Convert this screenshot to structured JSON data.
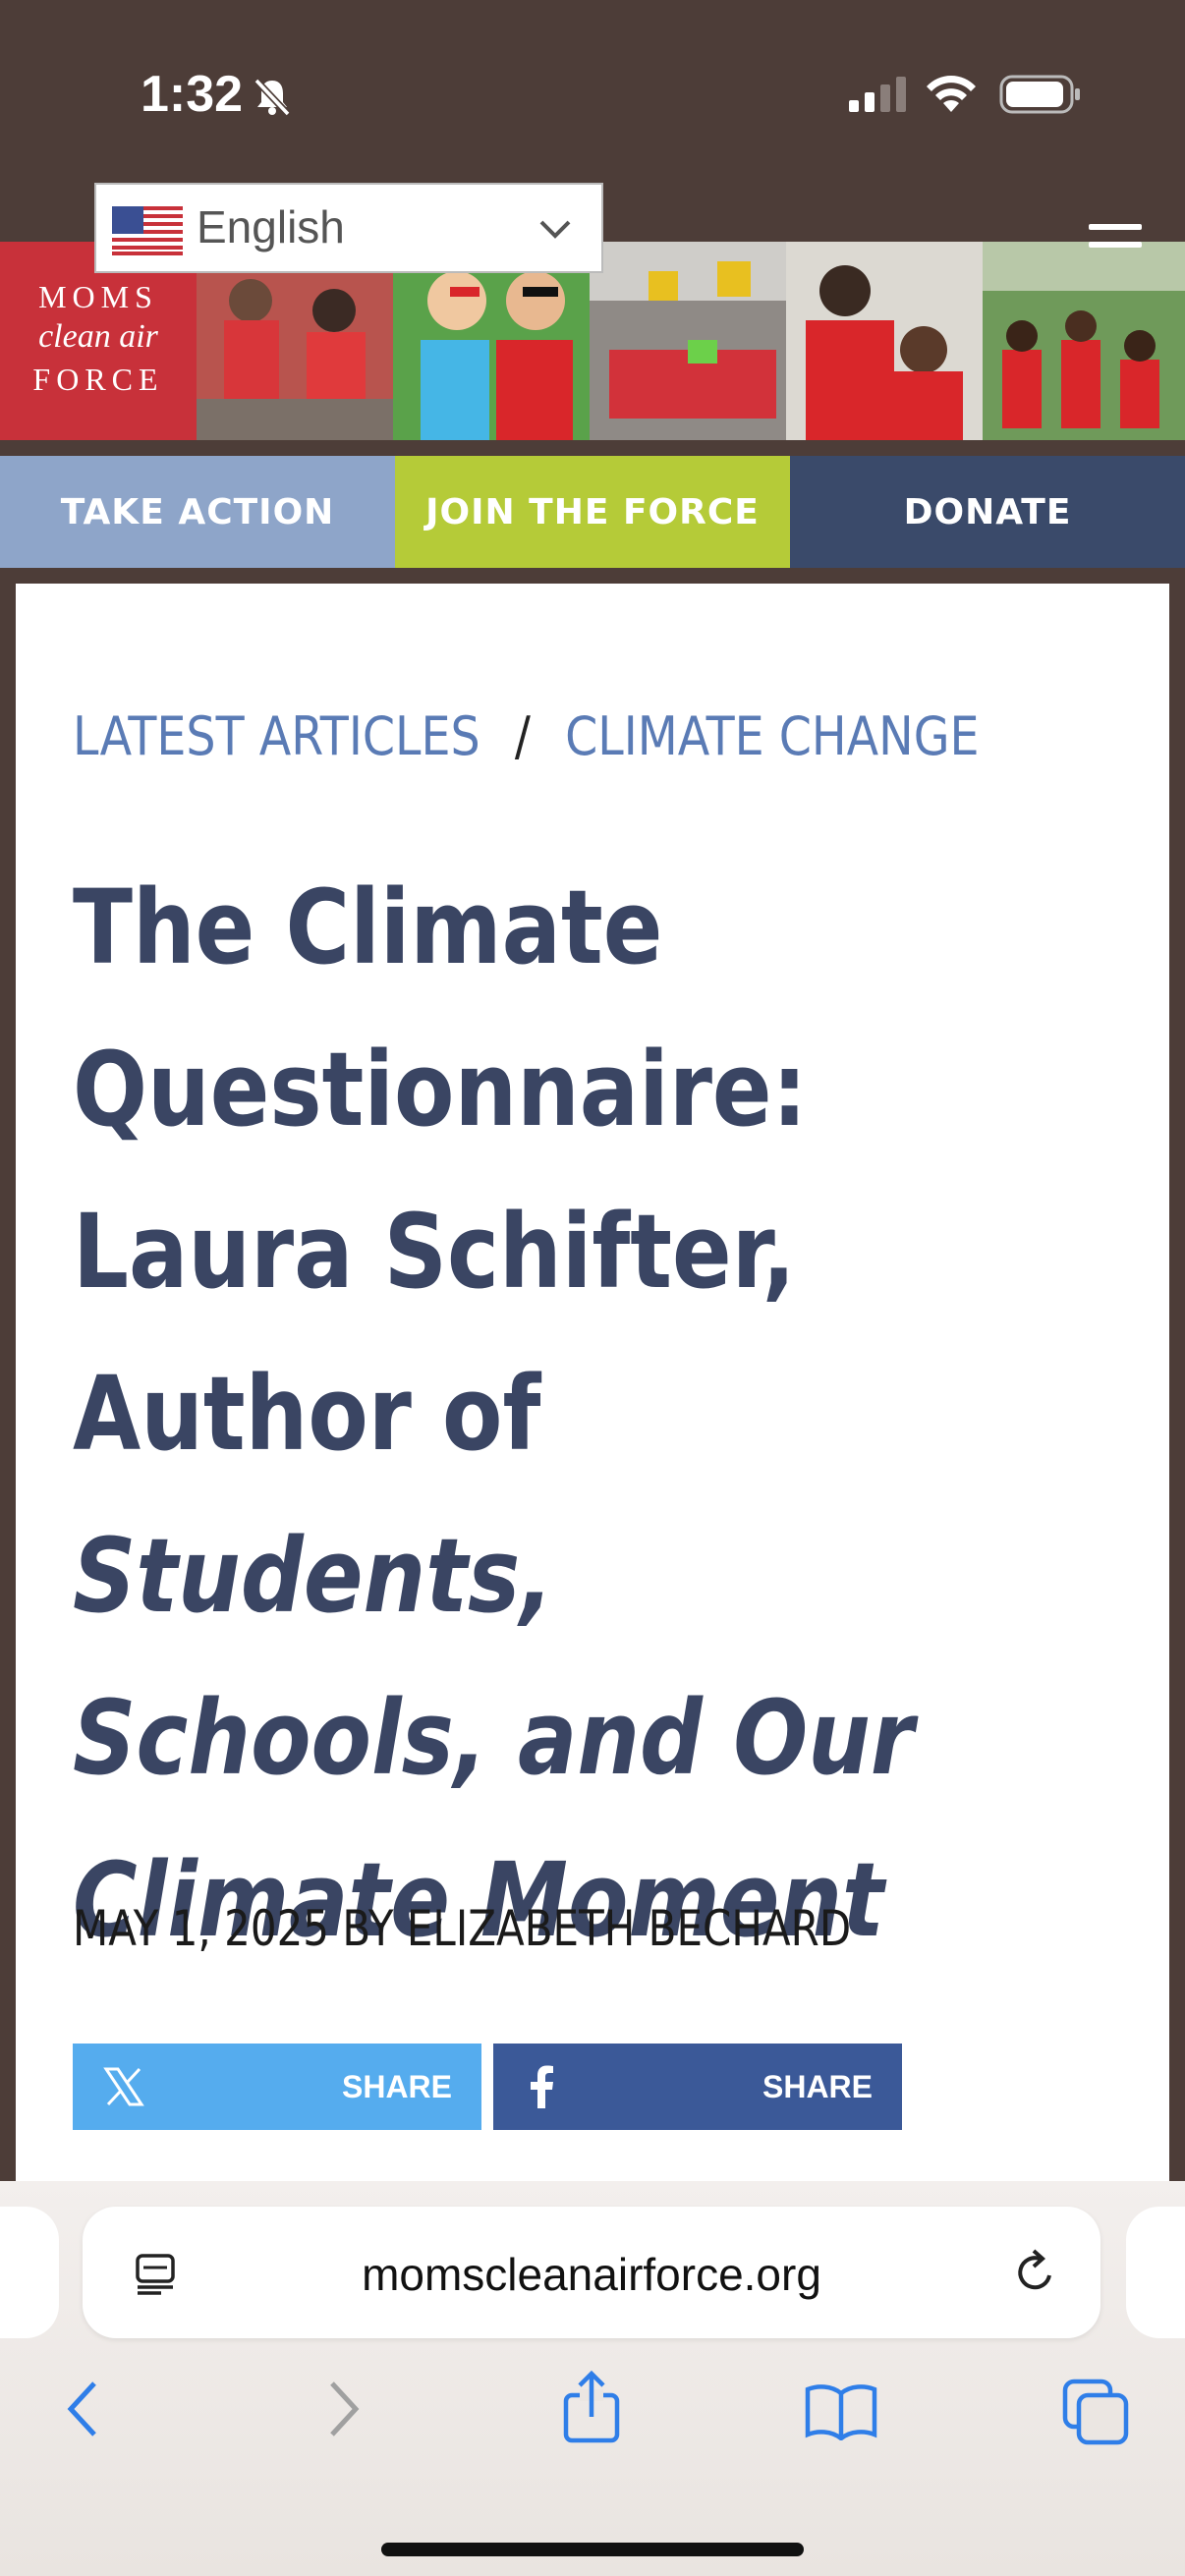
{
  "status_bar": {
    "time": "1:32"
  },
  "language_selector": {
    "label": "English"
  },
  "logo": {
    "line1": "MOMS",
    "line2": "clean air",
    "line3": "FORCE"
  },
  "nav": {
    "take_action": "TAKE ACTION",
    "join": "JOIN THE FORCE",
    "donate": "DONATE"
  },
  "breadcrumb": {
    "item1": "LATEST ARTICLES",
    "separator": "/",
    "item2": "CLIMATE CHANGE"
  },
  "article": {
    "title_plain": "The Climate Questionnaire: Laura Schifter, Author of",
    "title_italic": "Students, Schools, and Our Climate Moment",
    "byline": "MAY 1, 2025 BY ELIZABETH BECHARD"
  },
  "share": {
    "x_label": "SHARE",
    "facebook_label": "SHARE"
  },
  "browser": {
    "url": "momscleanairforce.org"
  },
  "colors": {
    "brand_red": "#c8313a",
    "nav_blue": "#8ea5c9",
    "nav_green": "#b5cb38",
    "nav_navy": "#3a4a6a",
    "title": "#3a4563"
  }
}
